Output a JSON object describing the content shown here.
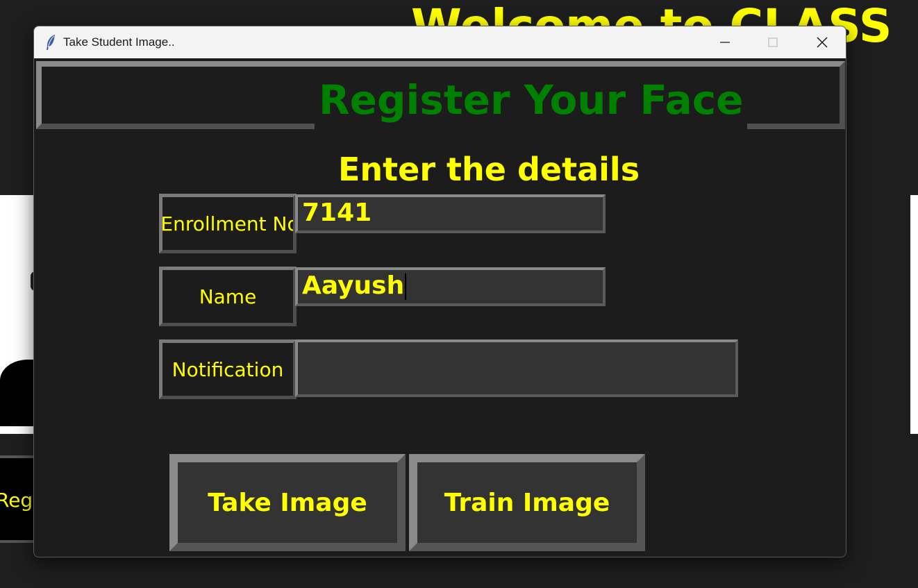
{
  "background": {
    "welcome_text": "Welcome to CLASS",
    "register_button_label": "Reg"
  },
  "window": {
    "title": "Take Student Image..",
    "icons": [
      "feather-icon",
      "minimize-icon",
      "maximize-icon",
      "close-icon"
    ]
  },
  "form": {
    "header_title": "Register Your Face",
    "subtitle": "Enter the details",
    "enrollment_label": "Enrollment No",
    "enrollment_value": "7141",
    "name_label": "Name",
    "name_value": "Aayush",
    "notification_label": "Notification",
    "notification_value": ""
  },
  "buttons": {
    "take_image": "Take Image",
    "train_image": "Train Image"
  },
  "colors": {
    "accent_yellow": "#ffff00",
    "header_green": "#008000",
    "background": "#1c1c1c",
    "input_bg": "#333333"
  }
}
